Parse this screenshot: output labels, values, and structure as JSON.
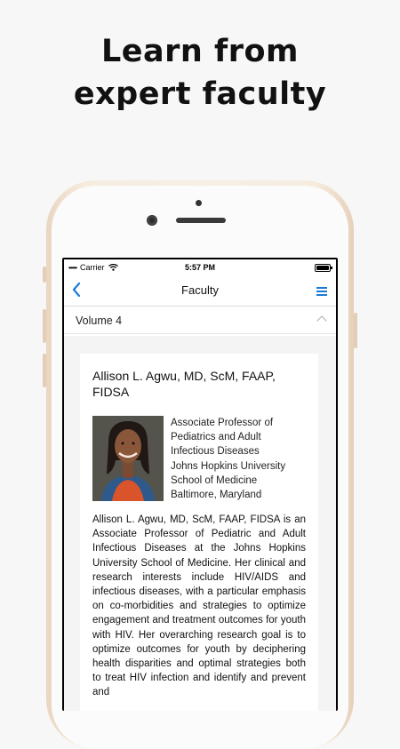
{
  "headline": {
    "line1": "Learn from",
    "line2": "expert faculty"
  },
  "status_bar": {
    "carrier": "Carrier",
    "time": "5:57 PM",
    "icons": [
      "wifi-icon",
      "battery-icon"
    ]
  },
  "nav": {
    "title": "Faculty",
    "back_icon": "chevron-left-icon",
    "menu_icon": "hamburger-menu-icon"
  },
  "section": {
    "title": "Volume 4",
    "expanded": true
  },
  "faculty": {
    "name": "Allison L. Agwu, MD, ScM, FAAP, FIDSA",
    "title_lines": [
      "Associate Professor of",
      "Pediatrics and Adult",
      "Infectious Diseases",
      "Johns Hopkins University",
      "School of Medicine",
      "Baltimore, Maryland"
    ],
    "bio": "Allison L. Agwu, MD, ScM, FAAP, FIDSA is an Associate Professor of Pediatric and Adult Infectious Diseases at the Johns Hopkins University School of Medicine. Her clinical and research interests include HIV/AIDS and infectious diseases, with a particular emphasis on co-morbidities and strategies to optimize engagement and treatment outcomes for youth with HIV. Her overarching research goal is to optimize outcomes for youth by deciphering health disparities and optimal strategies both to treat HIV infection and identify and prevent and"
  },
  "colors": {
    "accent": "#1a7bd6",
    "phone_frame": "#f6ebde"
  }
}
